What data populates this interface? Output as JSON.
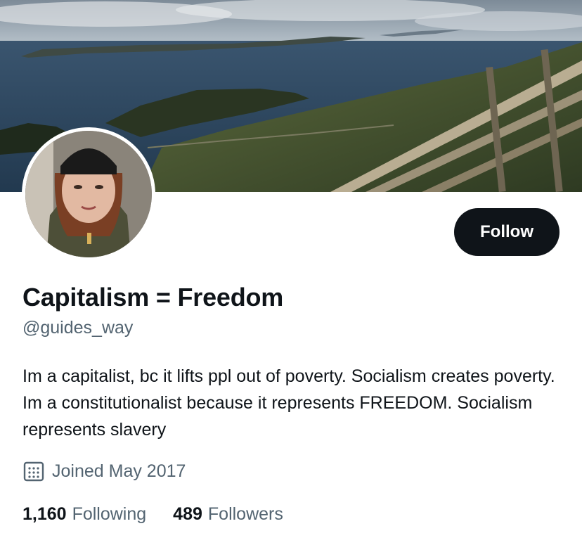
{
  "profile": {
    "display_name": "Capitalism = Freedom",
    "handle": "@guides_way",
    "bio": "Im a capitalist, bc it lifts ppl out of poverty. Socialism creates poverty. Im a constitutionalist because it represents FREEDOM. Socialism represents slavery",
    "joined": "Joined May 2017"
  },
  "actions": {
    "follow_label": "Follow"
  },
  "stats": {
    "following_count": "1,160",
    "following_label": "Following",
    "followers_count": "489",
    "followers_label": "Followers"
  },
  "icons": {
    "joined": "calendar-icon"
  },
  "colors": {
    "primary_text": "#0f1419",
    "secondary_text": "#536471",
    "follow_button_bg": "#0f1419",
    "follow_button_text": "#ffffff"
  }
}
